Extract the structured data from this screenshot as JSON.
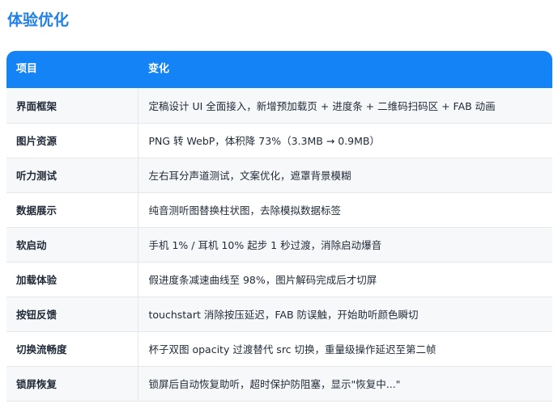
{
  "section": {
    "title": "体验优化"
  },
  "table": {
    "headers": [
      "项目",
      "变化"
    ],
    "rows": [
      {
        "item": "界面框架",
        "change": "定稿设计 UI 全面接入，新增预加载页 + 进度条 + 二维码扫码区 + FAB 动画"
      },
      {
        "item": "图片资源",
        "change": "PNG 转 WebP，体积降 73%（3.3MB → 0.9MB）"
      },
      {
        "item": "听力测试",
        "change": "左右耳分声道测试，文案优化，遮罩背景模糊"
      },
      {
        "item": "数据展示",
        "change": "纯音测听图替换柱状图，去除模拟数据标签"
      },
      {
        "item": "软启动",
        "change": "手机 1% / 耳机 10% 起步 1 秒过渡，消除启动爆音"
      },
      {
        "item": "加载体验",
        "change": "假进度条减速曲线至 98%，图片解码完成后才切屏"
      },
      {
        "item": "按钮反馈",
        "change": "touchstart 消除按压延迟，FAB 防误触，开始助听颜色瞬切"
      },
      {
        "item": "切换流畅度",
        "change": "杯子双图 opacity 过渡替代 src 切换，重量级操作延迟至第二帧"
      },
      {
        "item": "锁屏恢复",
        "change": "锁屏后自动恢复助听，超时保护防阻塞，显示\"恢复中...\""
      }
    ]
  }
}
